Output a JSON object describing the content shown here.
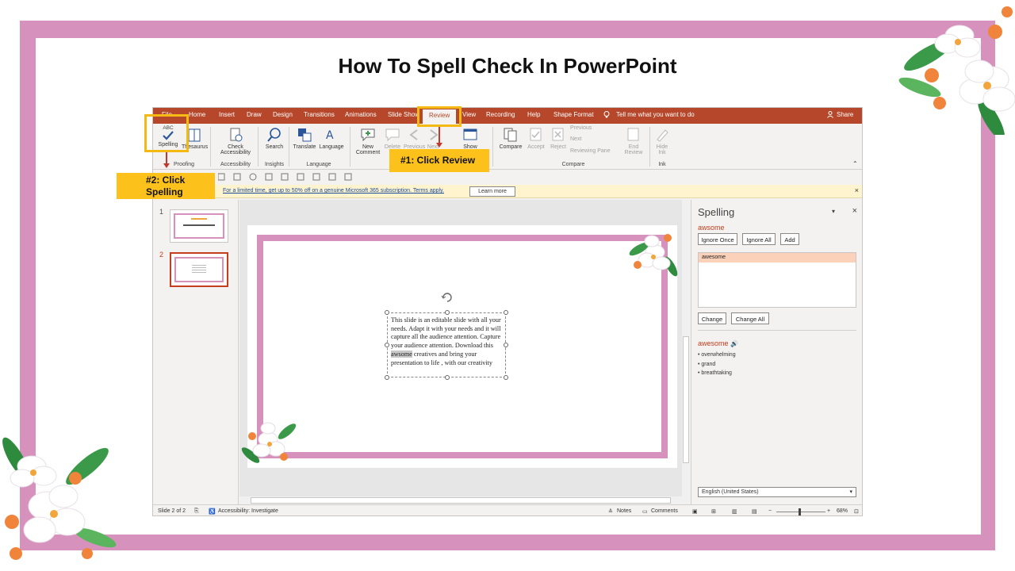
{
  "slide_title": "How To Spell Check In PowerPoint",
  "tabs": [
    {
      "label": "File"
    },
    {
      "label": "Home"
    },
    {
      "label": "Insert"
    },
    {
      "label": "Draw"
    },
    {
      "label": "Design"
    },
    {
      "label": "Transitions"
    },
    {
      "label": "Animations"
    },
    {
      "label": "Slide Show"
    },
    {
      "label": "Review"
    },
    {
      "label": "View"
    },
    {
      "label": "Recording"
    },
    {
      "label": "Help"
    },
    {
      "label": "Shape Format"
    }
  ],
  "tell_me": "Tell me what you want to do",
  "share": "Share",
  "ribbon": {
    "spelling": "Spelling",
    "thesaurus": "Thesaurus",
    "check_accessibility_1": "Check",
    "check_accessibility_2": "Accessibility",
    "search": "Search",
    "translate": "Translate",
    "language": "Language",
    "new_comment_1": "New",
    "new_comment_2": "Comment",
    "delete": "Delete",
    "previous_c": "Previous",
    "next_c": "Next",
    "show": "Show",
    "compare": "Compare",
    "accept": "Accept",
    "reject": "Reject",
    "previous": "Previous",
    "next": "Next",
    "reviewing_pane": "Reviewing Pane",
    "end_review_1": "End",
    "end_review_2": "Review",
    "hide_ink_1": "Hide",
    "hide_ink_2": "Ink",
    "groups": {
      "proofing": "Proofing",
      "accessibility": "Accessibility",
      "insights": "Insights",
      "language": "Language",
      "compare": "Compare",
      "ink": "Ink"
    },
    "abc": "ABC"
  },
  "notice": {
    "text": "For a limited time, get up to 50% off on a genuine Microsoft 365 subscription. Terms apply.",
    "button": "Learn more",
    "close": "×"
  },
  "thumbnails": [
    {
      "number": "1"
    },
    {
      "number": "2"
    }
  ],
  "textbox": {
    "before": "This slide is an editable slide with all your needs. Adapt it with your needs and it will capture all the audience attention. Capture your audience attention. Download this ",
    "highlight": "awsome",
    "after": " creatives and bring your presentation to life , with our creativity"
  },
  "pane": {
    "title": "Spelling",
    "close": "×",
    "dropdown": "▾",
    "error_word": "awsome",
    "ignore_once": "Ignore Once",
    "ignore_all": "Ignore All",
    "add": "Add",
    "suggestion": "awesome",
    "change": "Change",
    "change_all": "Change All",
    "synonym_word": "awesome",
    "synonyms": [
      "• overwhelming",
      "• grand",
      "• breathtaking"
    ],
    "language": "English (United States)"
  },
  "status": {
    "slide_of": "Slide 2 of 2",
    "accessibility": "Accessibility: Investigate",
    "notes": "Notes",
    "comments": "Comments",
    "zoom": "68%"
  },
  "callouts": {
    "review": "#1: Click Review",
    "spelling_1": "#2: Click",
    "spelling_2": "Spelling"
  },
  "colors": {
    "frame_pink": "#d691bd",
    "ribbon_red": "#b7472a",
    "callout_yellow": "#fdc11c",
    "error_red": "#c43e1c"
  }
}
